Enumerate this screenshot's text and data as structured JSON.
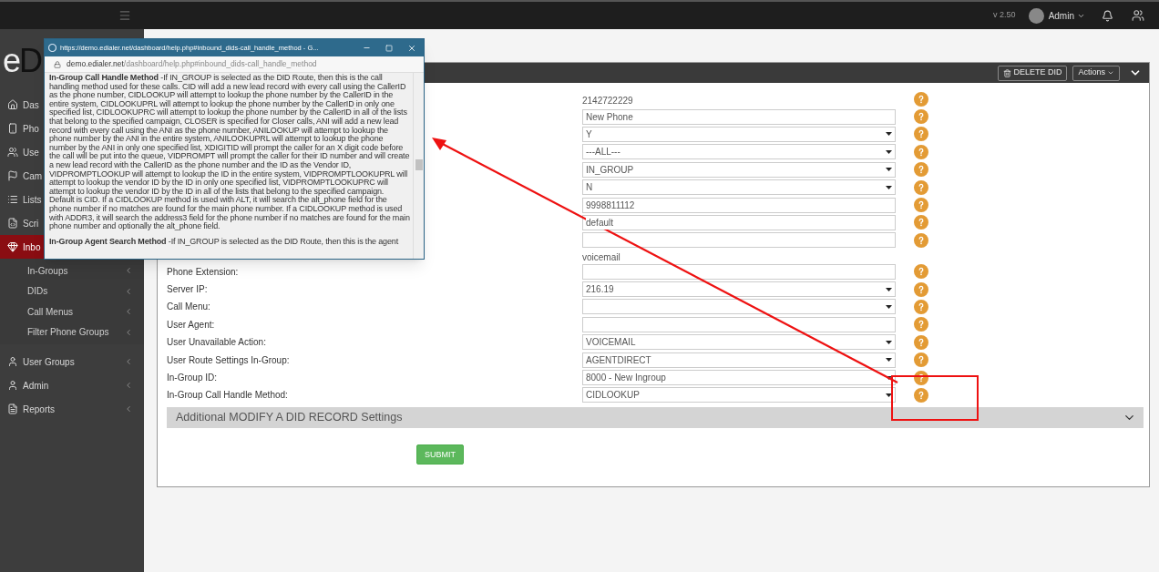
{
  "top_bar": {
    "version": "v 2.50",
    "user": "Admin"
  },
  "sidebar": {
    "logo": "eD",
    "items": [
      {
        "label": "Das",
        "selected": false
      },
      {
        "label": "Pho",
        "selected": false
      },
      {
        "label": "Use",
        "selected": false
      },
      {
        "label": "Cam",
        "selected": false
      },
      {
        "label": "Lists",
        "selected": false
      },
      {
        "label": "Scri",
        "selected": false
      },
      {
        "label": "Inbo",
        "selected": true,
        "expanded": true,
        "children": [
          {
            "label": "In-Groups",
            "arrow": true
          },
          {
            "label": "DIDs",
            "arrow": true
          },
          {
            "label": "Call Menus",
            "arrow": true
          },
          {
            "label": "Filter Phone Groups",
            "arrow": true
          }
        ]
      },
      {
        "label": "User Groups",
        "selected": false,
        "arrow": true
      },
      {
        "label": "Admin",
        "selected": false,
        "arrow": true
      },
      {
        "label": "Reports",
        "selected": false,
        "arrow": true
      }
    ]
  },
  "panel": {
    "buttons": [
      {
        "label": "DELETE DID",
        "kind": "delete"
      },
      {
        "label": "Actions",
        "kind": "dropdown"
      }
    ],
    "rows": [
      {
        "kind": "text",
        "value": "2142722229",
        "help": true
      },
      {
        "kind": "input",
        "value": "New Phone",
        "help": true
      },
      {
        "kind": "select",
        "value": "Y",
        "help": true
      },
      {
        "kind": "select",
        "value": "---ALL---",
        "help": true
      },
      {
        "kind": "select",
        "value": "IN_GROUP",
        "help": true
      },
      {
        "kind": "select",
        "value": "N",
        "help": true
      },
      {
        "kind": "input",
        "value": "9998811112",
        "help": true
      },
      {
        "kind": "input",
        "value": "default",
        "help": true
      },
      {
        "kind": "input",
        "help": true
      },
      {
        "kind": "text",
        "value": "voicemail",
        "help": false
      },
      {
        "kind": "input",
        "label": "Phone Extension:",
        "help": true
      },
      {
        "kind": "select",
        "label": "Server IP:",
        "value": "216.19",
        "help": true
      },
      {
        "kind": "select",
        "label": "Call Menu:",
        "help": true
      },
      {
        "kind": "input",
        "label": "User Agent:",
        "help": true
      },
      {
        "kind": "select",
        "label": "User Unavailable Action:",
        "value": "VOICEMAIL",
        "help": true
      },
      {
        "kind": "select",
        "label": "User Route Settings In-Group:",
        "value": "AGENTDIRECT",
        "help": true
      },
      {
        "kind": "select",
        "label": "In-Group ID:",
        "value": "8000 - New Ingroup",
        "help": true
      },
      {
        "kind": "select",
        "label": "In-Group Call Handle Method:",
        "value": "CIDLOOKUP",
        "help": true
      }
    ],
    "section": {
      "title": "Additional MODIFY A DID RECORD Settings",
      "expanded": false
    },
    "submit": "SUBMIT"
  },
  "popup": {
    "title": "https://demo.edialer.net/dashboard/help.php#inbound_dids-call_handle_method - G...",
    "address": {
      "host": "demo.edialer.net",
      "path": "/dashboard/help.php#inbound_dids-call_handle_method"
    },
    "paragraphs": [
      "**In-Group Call Handle Method** -If IN_GROUP is selected as the DID Route, then this is the call handling method used for these calls. CID will add a new lead record with every call using the CallerID as the phone number, CIDLOOKUP will attempt to lookup the phone number by the CallerID in the entire system, CIDLOOKUPRL will attempt to lookup the phone number by the CallerID in only one specified list, CIDLOOKUPRC will attempt to lookup the phone number by the CallerID in all of the lists that belong to the specified campaign, CLOSER is specified for Closer calls, ANI will add a new lead record with every call using the ANI as the phone number, ANILOOKUP will attempt to lookup the phone number by the ANI in the entire system, ANILOOKUPRL will attempt to lookup the phone number by the ANI in only one specified list, XDIGITID will prompt the caller for an X digit code before the call will be put into the queue, VIDPROMPT will prompt the caller for their ID number and will create a new lead record with the CallerID as the phone number and the ID as the Vendor ID, VIDPROMPTLOOKUP will attempt to lookup the ID in the entire system, VIDPROMPTLOOKUPRL will attempt to lookup the vendor ID by the ID in only one specified list, VIDPROMPTLOOKUPRC will attempt to lookup the vendor ID by the ID in all of the lists that belong to the specified campaign. Default is CID. If a CIDLOOKUP method is used with ALT, it will search the alt_phone field for the phone number if no matches are found for the main phone number. If a CIDLOOKUP method is used with ADDR3, it will search the address3 field for the phone number if no matches are found for the main phone number and optionally the alt_phone field.",
      "**In-Group Agent Search Method** -If IN_GROUP is selected as the DID Route, then this is the agent"
    ]
  }
}
